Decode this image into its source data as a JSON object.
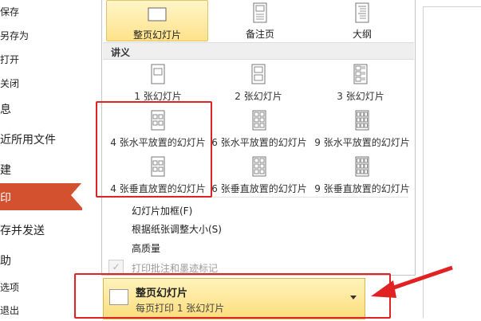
{
  "backstage": {
    "items": [
      {
        "label": "保存"
      },
      {
        "label": "另存为"
      },
      {
        "label": "打开"
      },
      {
        "label": "关闭"
      },
      {
        "label": "息"
      },
      {
        "label": "近所用文件"
      },
      {
        "label": "建"
      },
      {
        "label": "印"
      },
      {
        "label": "存并发送"
      },
      {
        "label": "助"
      },
      {
        "label": "选项"
      },
      {
        "label": "退出"
      }
    ]
  },
  "dropdown": {
    "print_layouts": [
      {
        "label": "整页幻灯片",
        "selected": true,
        "icon": "full-page-slide-icon"
      },
      {
        "label": "备注页",
        "selected": false,
        "icon": "notes-page-icon"
      },
      {
        "label": "大纲",
        "selected": false,
        "icon": "outline-icon"
      }
    ],
    "handouts_header": "讲义",
    "handouts": [
      {
        "label": "1 张幻灯片",
        "icon": "handout-1-icon"
      },
      {
        "label": "2 张幻灯片",
        "icon": "handout-2-icon"
      },
      {
        "label": "3 张幻灯片",
        "icon": "handout-3-icon"
      },
      {
        "label": "4 张水平放置的幻灯片",
        "icon": "handout-4-horizontal-icon"
      },
      {
        "label": "6 张水平放置的幻灯片",
        "icon": "handout-6-horizontal-icon"
      },
      {
        "label": "9 张水平放置的幻灯片",
        "icon": "handout-9-horizontal-icon"
      },
      {
        "label": "4 张垂直放置的幻灯片",
        "icon": "handout-4-vertical-icon"
      },
      {
        "label": "6 张垂直放置的幻灯片",
        "icon": "handout-6-vertical-icon"
      },
      {
        "label": "9 张垂直放置的幻灯片",
        "icon": "handout-9-vertical-icon"
      }
    ],
    "options": [
      {
        "label": "幻灯片加框(F)",
        "enabled": true
      },
      {
        "label": "根据纸张调整大小(S)",
        "enabled": true
      },
      {
        "label": "高质量",
        "enabled": true
      },
      {
        "label": "打印批注和墨迹标记",
        "enabled": false
      }
    ]
  },
  "combo": {
    "title": "整页幻灯片",
    "subtitle": "每页打印 1 张幻灯片"
  },
  "colors": {
    "active_menu": "#d3512e",
    "highlight": "#fde28a",
    "annotation_red": "#e02222"
  }
}
